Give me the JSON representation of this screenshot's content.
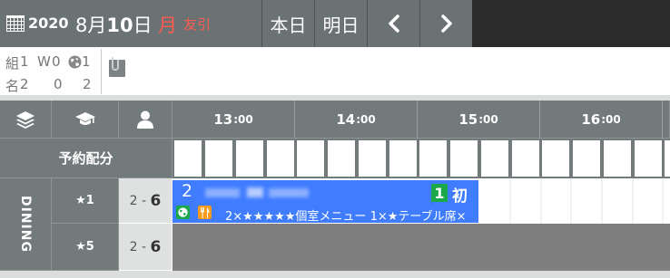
{
  "header": {
    "year": "2020",
    "month": "8月",
    "day": "10",
    "day_suffix": "日",
    "weekday": "月",
    "rokuyo": "友引",
    "today_label": "本日",
    "tomorrow_label": "明日"
  },
  "summary": {
    "row1": {
      "a_label": "組",
      "a_value": "1",
      "b_label": "W",
      "b_value": "0",
      "c_value": "1"
    },
    "row2": {
      "a_label": "名",
      "a_value": "2",
      "b_value": "0",
      "c_value": "2"
    }
  },
  "grid": {
    "allocation_label": "予約配分",
    "times": [
      {
        "hour": "13",
        "min": ":00"
      },
      {
        "hour": "14",
        "min": ":00"
      },
      {
        "hour": "15",
        "min": ":00"
      },
      {
        "hour": "16",
        "min": ":00"
      }
    ],
    "section_label": "DINING",
    "rows": [
      {
        "rank": "★1",
        "cap_min": "2",
        "cap_sep": "-",
        "cap_max": "6"
      },
      {
        "rank": "★5",
        "cap_min": "2",
        "cap_sep": "-",
        "cap_max": "6"
      }
    ]
  },
  "reservation": {
    "party_size": "2",
    "tag_count": "1",
    "first_visit": "初",
    "details": "2×★★★★★個室メニュー 1×★テーブル席×"
  },
  "colors": {
    "topbar": "#6b7274",
    "accent_red": "#ff5a4e",
    "reservation_blue": "#3f7cff",
    "badge_green": "#1aa84a",
    "fork_orange": "#f59a1a"
  }
}
